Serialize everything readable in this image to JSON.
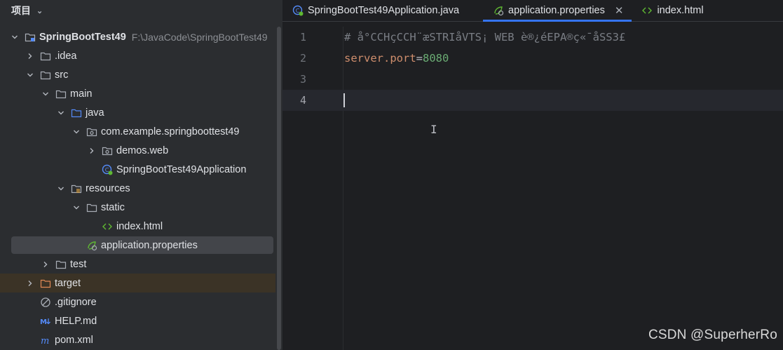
{
  "project_panel": {
    "title": "项目",
    "tree": [
      {
        "label": "SpringBootTest49",
        "path": "F:\\JavaCode\\SpringBootTest49",
        "icon": "module-folder-icon",
        "depth": 0,
        "arrow": "down"
      },
      {
        "label": ".idea",
        "icon": "folder-icon",
        "depth": 1,
        "arrow": "right"
      },
      {
        "label": "src",
        "icon": "folder-icon",
        "depth": 1,
        "arrow": "down"
      },
      {
        "label": "main",
        "icon": "folder-icon",
        "depth": 2,
        "arrow": "down"
      },
      {
        "label": "java",
        "icon": "source-folder-icon",
        "depth": 3,
        "arrow": "down"
      },
      {
        "label": "com.example.springboottest49",
        "icon": "package-icon",
        "depth": 4,
        "arrow": "down"
      },
      {
        "label": "demos.web",
        "icon": "package-icon",
        "depth": 5,
        "arrow": "right"
      },
      {
        "label": "SpringBootTest49Application",
        "icon": "spring-class-icon",
        "depth": 5,
        "arrow": "none"
      },
      {
        "label": "resources",
        "icon": "resources-folder-icon",
        "depth": 3,
        "arrow": "down"
      },
      {
        "label": "static",
        "icon": "folder-icon",
        "depth": 4,
        "arrow": "down"
      },
      {
        "label": "index.html",
        "icon": "html-file-icon",
        "depth": 5,
        "arrow": "none"
      },
      {
        "label": "application.properties",
        "icon": "spring-properties-icon",
        "depth": 4,
        "arrow": "none",
        "selected": true
      },
      {
        "label": "test",
        "icon": "folder-icon",
        "depth": 2,
        "arrow": "right"
      },
      {
        "label": "target",
        "icon": "excluded-folder-icon",
        "depth": 1,
        "arrow": "right",
        "excluded": true
      },
      {
        "label": ".gitignore",
        "icon": "gitignore-icon",
        "depth": 1,
        "arrow": "none"
      },
      {
        "label": "HELP.md",
        "icon": "markdown-icon",
        "depth": 1,
        "arrow": "none"
      },
      {
        "label": "pom.xml",
        "icon": "maven-icon",
        "depth": 1,
        "arrow": "none"
      }
    ]
  },
  "editor": {
    "tabs": [
      {
        "label": "SpringBootTest49Application.java",
        "icon": "spring-class-icon",
        "active": false
      },
      {
        "label": "application.properties",
        "icon": "spring-properties-icon",
        "active": true,
        "closable": true
      },
      {
        "label": "index.html",
        "icon": "html-file-icon",
        "active": false
      }
    ],
    "lines": [
      {
        "number": "1",
        "comment": "# å°CCHçCCH¨æSTRIåVTS¡ WEB è®¿éEPA®ç«¯åSS3£"
      },
      {
        "number": "2",
        "key": "server.port",
        "eq": "=",
        "value": "8080"
      },
      {
        "number": "3"
      },
      {
        "number": "4",
        "current": true
      }
    ],
    "cursor_glyph": "I"
  },
  "watermark": "CSDN @SuperherRo",
  "colors": {
    "accent": "#3574f0",
    "comment": "#7a7e85",
    "property_key": "#cf8e6d",
    "property_value": "#6aab73",
    "folder_icon": "#a8adb5",
    "source_folder_icon": "#548af7",
    "spring_icon": "#5fb832"
  }
}
